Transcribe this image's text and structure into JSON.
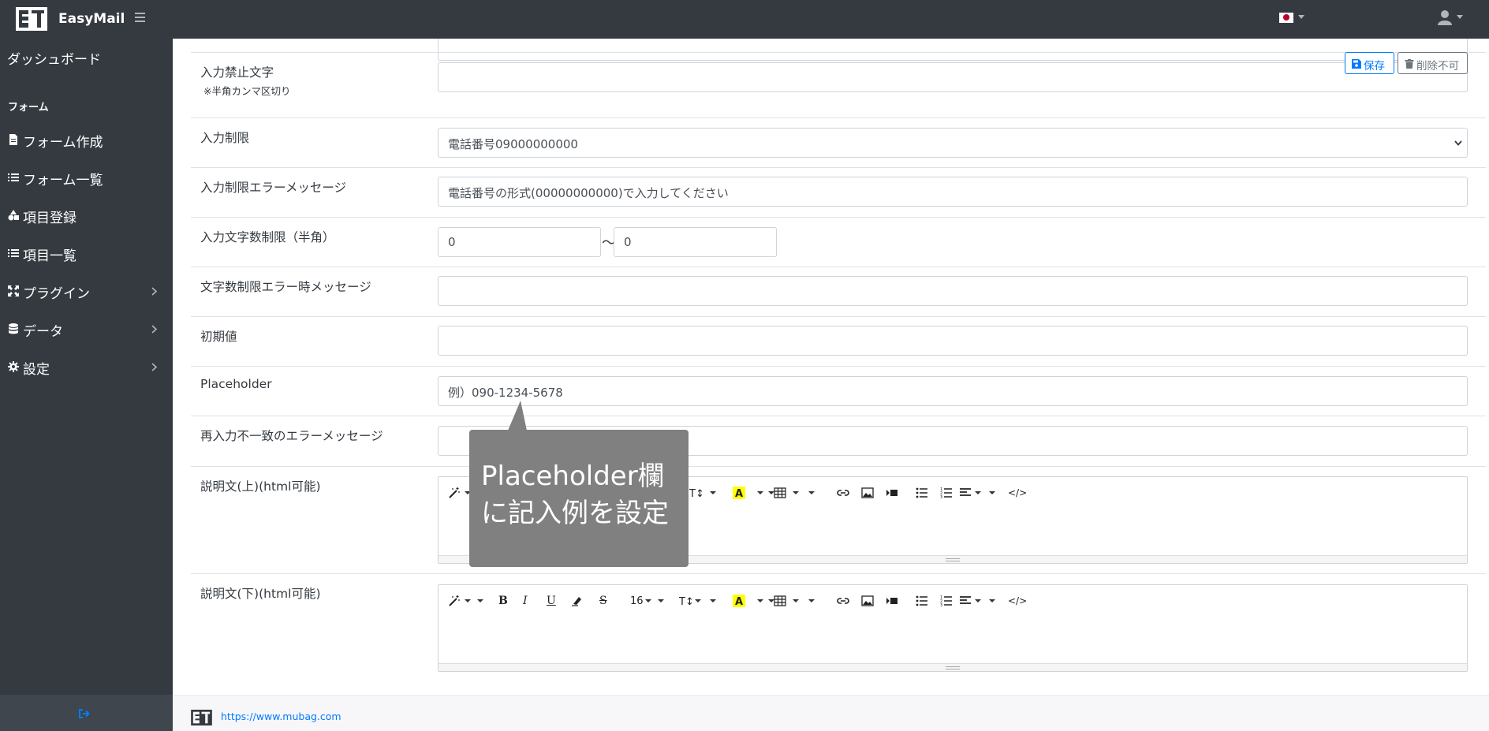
{
  "header": {
    "brand": "EasyMail",
    "logo_text": "E1",
    "language": "ja",
    "icons": [
      "logo-icon",
      "hamburger-icon",
      "japan-flag-icon",
      "user-icon"
    ]
  },
  "sidebar": {
    "dashboard": "ダッシュボード",
    "section_heading": "フォーム",
    "items": [
      {
        "label": "フォーム作成",
        "icon": "file-icon",
        "has_chevron": false
      },
      {
        "label": "フォーム一覧",
        "icon": "list-icon",
        "has_chevron": false
      },
      {
        "label": "項目登録",
        "icon": "shapes-icon",
        "has_chevron": false
      },
      {
        "label": "項目一覧",
        "icon": "list-icon",
        "has_chevron": false
      },
      {
        "label": "プラグイン",
        "icon": "expand-icon",
        "has_chevron": true
      },
      {
        "label": "データ",
        "icon": "database-icon",
        "has_chevron": true
      },
      {
        "label": "設定",
        "icon": "gear-icon",
        "has_chevron": true
      }
    ],
    "footer_icon": "logout-icon"
  },
  "actions": {
    "save": "保存",
    "delete": "削除不可"
  },
  "form": {
    "forbidden_chars": {
      "label": "入力禁止文字",
      "sublabel": "※半角カンマ区切り",
      "value": ""
    },
    "restriction": {
      "label": "入力制限",
      "value": "電話番号09000000000"
    },
    "restriction_error": {
      "label": "入力制限エラーメッセージ",
      "value": "電話番号の形式(00000000000)で入力してください"
    },
    "length_limit": {
      "label": "入力文字数制限（半角）",
      "min": "0",
      "max": "0",
      "separator": "〜"
    },
    "length_error": {
      "label": "文字数制限エラー時メッセージ",
      "value": ""
    },
    "initial_value": {
      "label": "初期値",
      "value": ""
    },
    "placeholder": {
      "label": "Placeholder",
      "value": "例）090-1234-5678"
    },
    "reentry_error": {
      "label": "再入力不一致のエラーメッセージ",
      "value": ""
    },
    "desc_top": {
      "label": "説明文(上)(html可能)"
    },
    "desc_bottom": {
      "label": "説明文(下)(html可能)"
    }
  },
  "editor_toolbar": {
    "font_size": "16",
    "bold": "B",
    "italic": "I",
    "underline": "U",
    "strike": "S",
    "code": "</>",
    "icons": [
      "magic-icon",
      "bold-icon",
      "italic-icon",
      "underline-icon",
      "eraser-icon",
      "strikethrough-icon",
      "font-size-icon",
      "text-height-icon",
      "highlight-icon",
      "table-icon",
      "link-icon",
      "image-icon",
      "video-icon",
      "unordered-list-icon",
      "ordered-list-icon",
      "align-icon",
      "code-view-icon"
    ]
  },
  "callout": {
    "line1": "Placeholder欄",
    "line2": "に記入例を設定"
  },
  "footer": {
    "link": "https://www.mubag.com"
  },
  "colors": {
    "navbar": "#343a40",
    "primary": "#007bff",
    "secondary": "#6c757d",
    "callout": "#808080"
  }
}
